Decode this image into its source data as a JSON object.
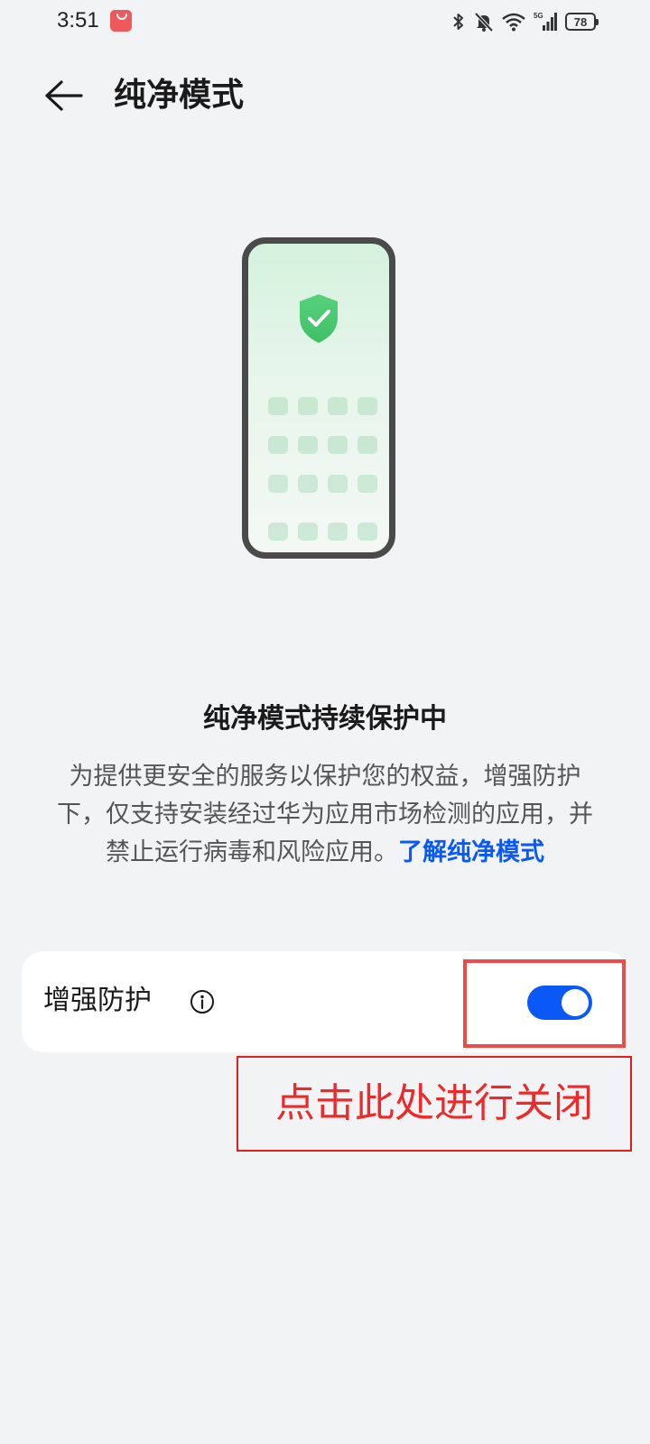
{
  "status_bar": {
    "time": "3:51",
    "battery": "78",
    "signal_label": "5G"
  },
  "header": {
    "title": "纯净模式"
  },
  "main": {
    "status_heading": "纯净模式持续保护中",
    "description": "为提供更安全的服务以保护您的权益，增强防护下，仅支持安装经过华为应用市场检测的应用，并禁止运行病毒和风险应用。",
    "learn_more_link": "了解纯净模式"
  },
  "setting": {
    "label": "增强防护",
    "toggle_on": true
  },
  "annotation": {
    "text": "点击此处进行关闭"
  },
  "colors": {
    "accent": "#0a59f7",
    "annotation_red": "#ec2a2a",
    "background": "#f1f3f5"
  }
}
